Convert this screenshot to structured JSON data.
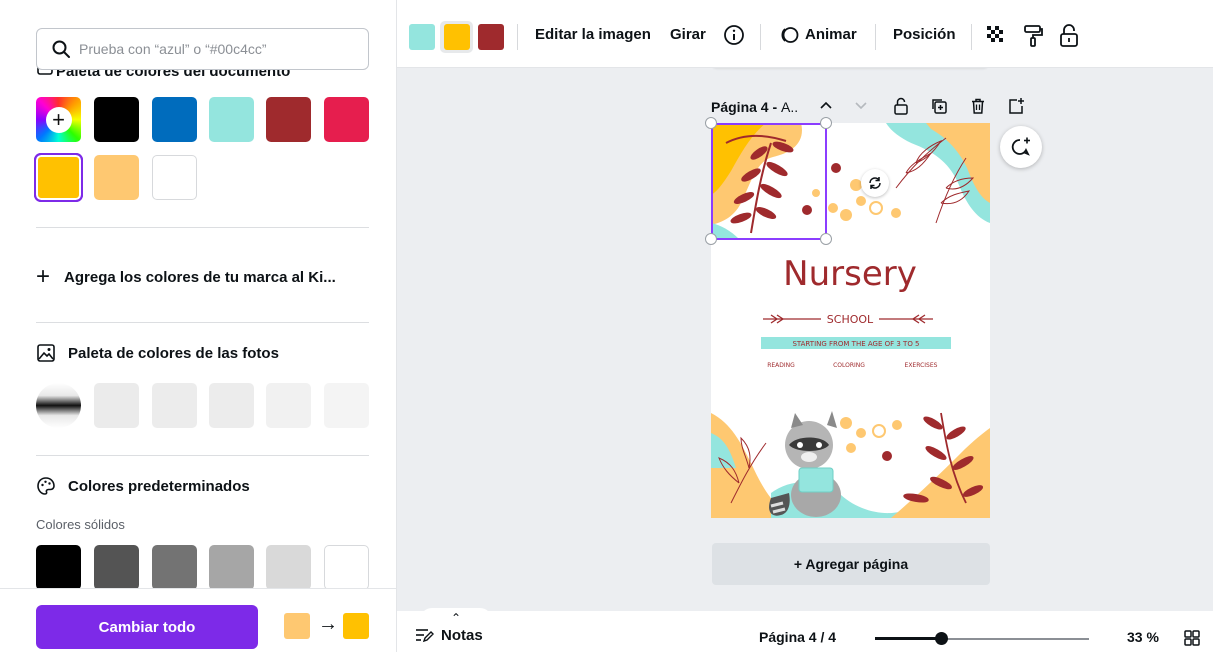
{
  "left_panel": {
    "search": {
      "placeholder": "Prueba con “azul” o “#00c4cc”"
    },
    "document_palette": {
      "title": "Paleta de colores del documento",
      "add_color_label": "+",
      "colors": [
        "#000000",
        "#006cbd",
        "#94e5de",
        "#9f2a2d",
        "#e61e4e",
        "#ffc101",
        "#fec871",
        "#ffffff"
      ]
    },
    "brand": {
      "label": "Agrega los colores de tu marca al Ki..."
    },
    "photo_palette": {
      "title": "Paleta de colores de las fotos",
      "colors": [
        "#ebebeb",
        "#ececec",
        "#ececec",
        "#f1f1f1",
        "#f4f4f4"
      ]
    },
    "default_colors": {
      "title": "Colores predeterminados",
      "subtitle": "Colores sólidos",
      "colors": [
        "#000000",
        "#545454",
        "#737373",
        "#a6a6a6",
        "#d9d9d9",
        "#ffffff"
      ]
    },
    "change_all": {
      "button_label": "Cambiar todo",
      "from_color": "#fec871",
      "arrow": "→",
      "to_color": "#ffc101"
    }
  },
  "toolbar": {
    "swatches": [
      "#94e5de",
      "#ffc101",
      "#9f2a2d"
    ],
    "edit_image": "Editar la imagen",
    "rotate": "Girar",
    "animate": "Animar",
    "position": "Posición"
  },
  "canvas": {
    "page_title": "Página 4 - ",
    "page_title_suffix": "A..",
    "design": {
      "headline": "Nursery",
      "subheadline": "SCHOOL",
      "banner": "STARTING FROM THE AGE OF 3 TO 5",
      "activities": [
        "READING",
        "COLORING",
        "EXERCISES"
      ]
    },
    "add_page": "+ Agregar página",
    "collapse_glyph": "⌃"
  },
  "footer": {
    "notes": "Notas",
    "page_indicator": "Página 4 / 4",
    "zoom": "33 %",
    "zoom_fraction": 0.31
  }
}
